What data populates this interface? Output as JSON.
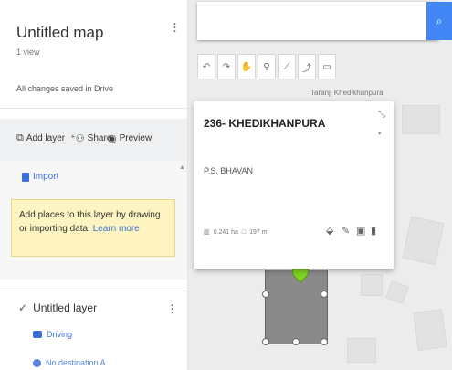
{
  "sidebar": {
    "title": "Untitled map",
    "views": "1 view",
    "status": "All changes saved in Drive",
    "actions": {
      "add_layer": "Add layer",
      "share": "Share",
      "preview": "Preview"
    },
    "import": "Import",
    "tip_text": "Add places to this layer by drawing or importing data.",
    "tip_link": "Learn more",
    "layer2": {
      "name": "Untitled layer",
      "driving": "Driving",
      "destination": "No destination A"
    }
  },
  "map": {
    "search_placeholder": "",
    "map_label": "Taranji Khedikhanpura",
    "tool_icons": [
      "undo-icon",
      "redo-icon",
      "hand-icon",
      "marker-icon",
      "line-icon",
      "route-icon",
      "ruler-icon"
    ]
  },
  "card": {
    "title": "236- KHEDIKHANPURA",
    "subtitle": "P.S. BHAVAN",
    "area": "0.241 ha",
    "length": "197 m"
  },
  "colors": {
    "accent": "#4285f4",
    "pin": "#7ed321",
    "tip_bg": "#fdf4c1"
  }
}
